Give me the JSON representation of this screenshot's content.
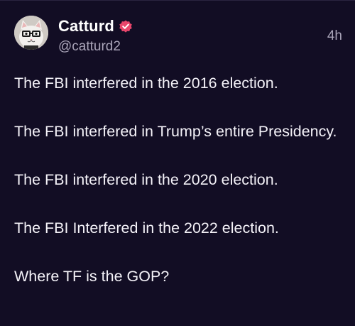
{
  "post": {
    "author": {
      "display_name": "Catturd",
      "handle": "@catturd2",
      "verified": true,
      "badge_color": "#e8456b"
    },
    "timestamp": "4h",
    "paragraphs": [
      "The FBI interfered in the 2016 election.",
      "The FBI interfered in Trump’s entire Presidency.",
      "The FBI interfered in the 2020 election.",
      "The FBI Interfered in the 2022 election.",
      "Where TF is the GOP?"
    ]
  },
  "theme": {
    "background": "#120d24",
    "text": "#f4f2f8",
    "muted_text": "#a9a4b8"
  },
  "icons": {
    "avatar": "cat-with-glasses-avatar",
    "verified": "verified-badge-icon"
  }
}
